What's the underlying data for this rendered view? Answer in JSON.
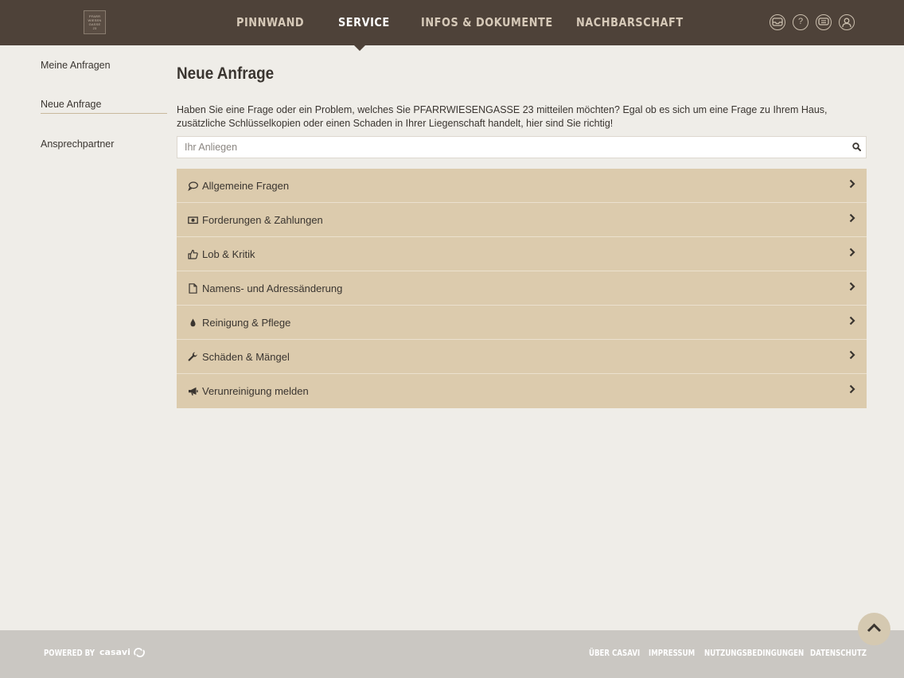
{
  "header": {
    "logo_text": [
      "PFARR",
      "WIESEN",
      "GASSE",
      "23"
    ],
    "nav": [
      {
        "label": "PINNWAND",
        "active": false
      },
      {
        "label": "SERVICE",
        "active": true
      },
      {
        "label": "INFOS & DOKUMENTE",
        "active": false
      },
      {
        "label": "NACHBARSCHAFT",
        "active": false
      }
    ],
    "icons": [
      "inbox-icon",
      "help-icon",
      "chat-icon",
      "user-icon"
    ]
  },
  "sidebar": {
    "items": [
      {
        "label": "Meine Anfragen"
      },
      {
        "label": "Neue Anfrage",
        "active": true
      },
      {
        "label": "Ansprechpartner"
      }
    ]
  },
  "main": {
    "title": "Neue Anfrage",
    "intro": "Haben Sie eine Frage oder ein Problem, welches Sie PFARRWIESENGASSE 23 mitteilen möchten? Egal ob es sich um eine Frage zu Ihrem Haus, zusätzliche Schlüsselkopien oder einen Schaden in Ihrer Liegenschaft handelt, hier sind Sie richtig!",
    "search": {
      "placeholder": "Ihr Anliegen",
      "value": ""
    },
    "categories": [
      {
        "label": "Allgemeine Fragen",
        "icon": "speech-bubble-icon"
      },
      {
        "label": "Forderungen & Zahlungen",
        "icon": "money-icon"
      },
      {
        "label": "Lob & Kritik",
        "icon": "thumbs-up-icon"
      },
      {
        "label": "Namens- und Adressänderung",
        "icon": "document-icon"
      },
      {
        "label": "Reinigung & Pflege",
        "icon": "drop-icon"
      },
      {
        "label": "Schäden & Mängel",
        "icon": "wrench-icon"
      },
      {
        "label": "Verunreinigung melden",
        "icon": "megaphone-icon"
      }
    ]
  },
  "footer": {
    "powered_by": "POWERED BY",
    "brand": "casavi",
    "links": [
      "ÜBER CASAVI",
      "IMPRESSUM",
      "NUTZUNGSBEDINGUNGEN",
      "DATENSCHUTZ"
    ]
  },
  "colors": {
    "header_bg": "#4e4239",
    "page_bg": "#efede8",
    "category_bg": "#dccbad",
    "footer_bg": "#cac7c2"
  }
}
